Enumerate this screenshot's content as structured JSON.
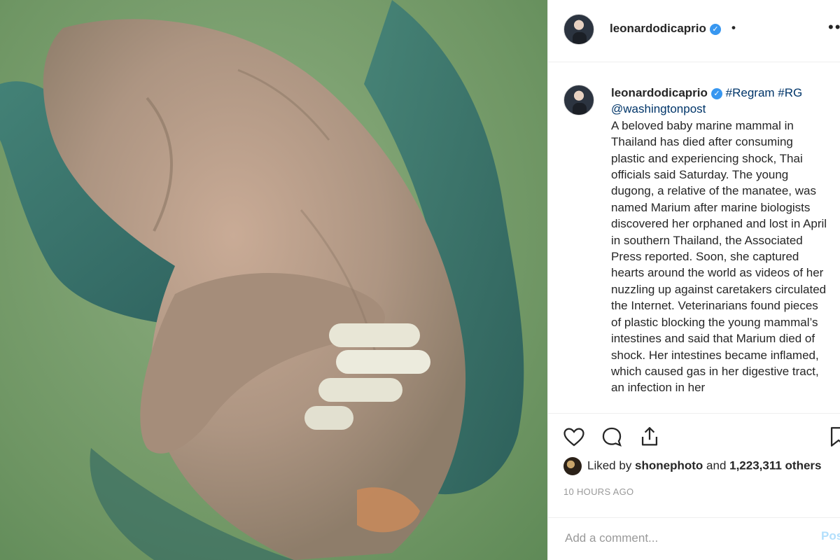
{
  "post": {
    "photo_description_icon": "dugong-photo"
  },
  "header": {
    "username": "leonardodicaprio",
    "verified_icon": "verified-badge-icon",
    "dot": "•",
    "more": "••"
  },
  "caption": {
    "username": "leonardodicaprio",
    "tags": "#Regram #RG",
    "mention": "@washingtonpost",
    "text": "A beloved baby marine mammal in Thailand has died after consuming plastic and experiencing shock, Thai officials said Saturday. The young dugong, a relative of the manatee, was named Marium after marine biologists discovered her orphaned and lost in April in southern Thailand, the Associated Press reported. Soon, she captured hearts around the world as videos of her nuzzling up against caretakers circulated the Internet. Veterinarians found pieces of plastic blocking the young mammal’s intestines and said that Marium died of shock. Her intestines became inflamed, which caused gas in her digestive tract, an infection in her"
  },
  "actions": {
    "like_icon": "heart-icon",
    "comment_icon": "comment-icon",
    "share_icon": "share-icon",
    "save_icon": "bookmark-icon"
  },
  "likes": {
    "prefix": "Liked by ",
    "user": "shonephoto",
    "middle": " and ",
    "count": "1,223,311 others"
  },
  "timestamp": "10 HOURS AGO",
  "comment": {
    "placeholder": "Add a comment...",
    "post_label": "Post"
  },
  "colors": {
    "link": "#003569",
    "verified": "#3897f0",
    "water": "#7ea272"
  }
}
